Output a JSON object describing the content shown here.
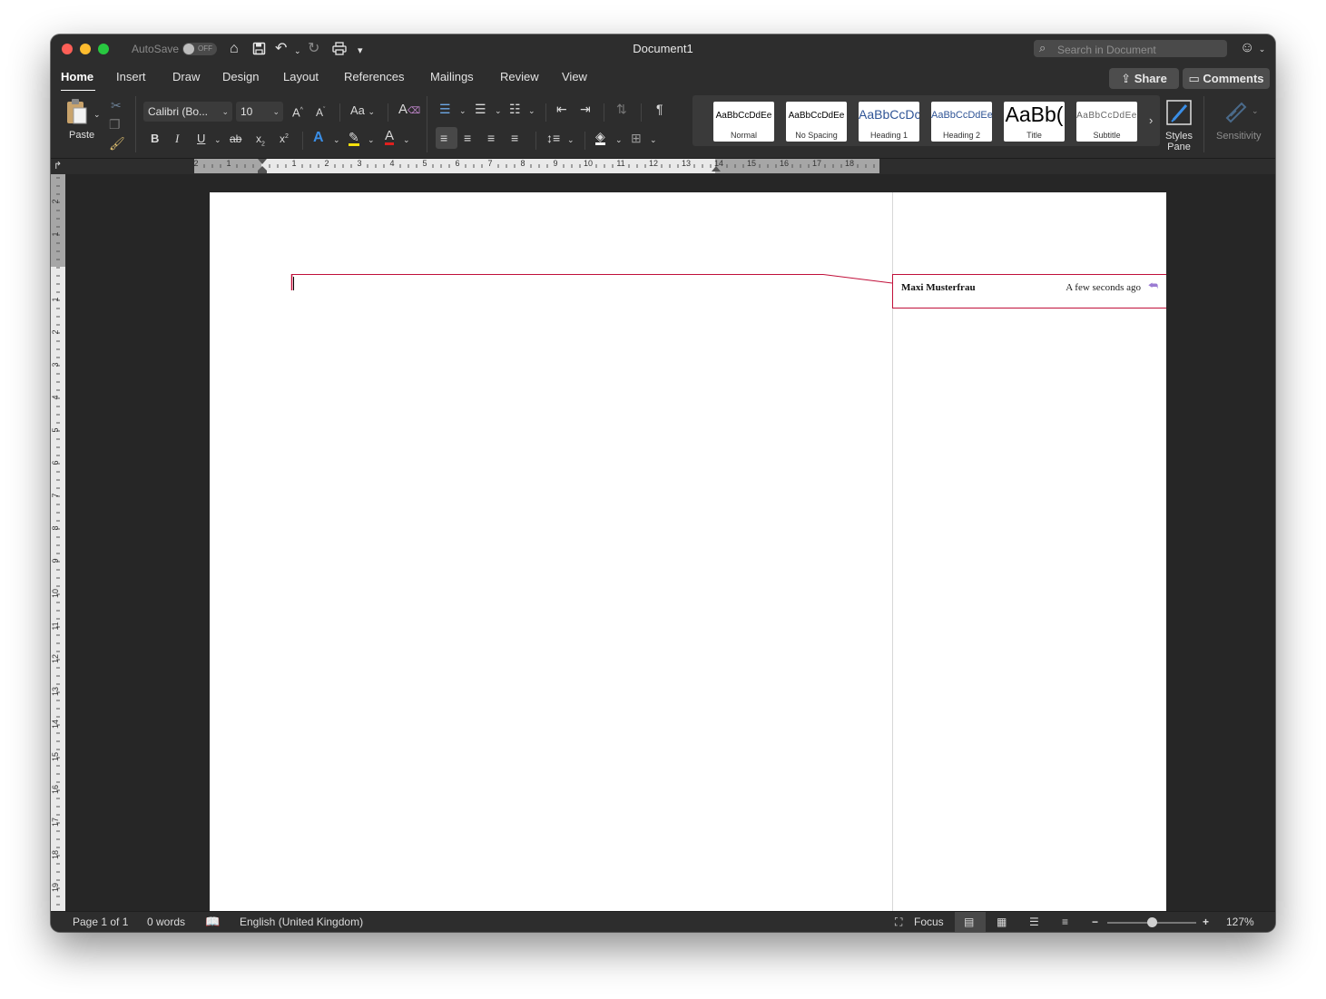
{
  "window": {
    "title": "Document1",
    "autosave_label": "AutoSave",
    "autosave_state": "OFF",
    "search_placeholder": "Search in Document"
  },
  "tabs": [
    {
      "label": "Home",
      "active": true
    },
    {
      "label": "Insert"
    },
    {
      "label": "Draw"
    },
    {
      "label": "Design"
    },
    {
      "label": "Layout"
    },
    {
      "label": "References"
    },
    {
      "label": "Mailings"
    },
    {
      "label": "Review"
    },
    {
      "label": "View"
    }
  ],
  "header_buttons": {
    "share": "Share",
    "comments": "Comments"
  },
  "ribbon": {
    "paste_label": "Paste",
    "font_name": "Calibri (Bo...",
    "font_size": "10",
    "change_case_label": "Aa",
    "styles": [
      {
        "sample": "AaBbCcDdEe",
        "label": "Normal",
        "color": "#000000"
      },
      {
        "sample": "AaBbCcDdEe",
        "label": "No Spacing",
        "color": "#000000"
      },
      {
        "sample": "AaBbCcDc",
        "label": "Heading 1",
        "color": "#2f5496"
      },
      {
        "sample": "AaBbCcDdEe",
        "label": "Heading 2",
        "color": "#2f5496"
      },
      {
        "sample": "AaBb(",
        "label": "Title",
        "color": "#000000"
      },
      {
        "sample": "AaBbCcDdEe",
        "label": "Subtitle",
        "color": "#666666"
      }
    ],
    "styles_pane_label": "Styles Pane",
    "sensitivity_label": "Sensitivity"
  },
  "ruler": {
    "h_labels": [
      "2",
      "1",
      "1",
      "2",
      "3",
      "4",
      "5",
      "6",
      "7",
      "8",
      "9",
      "10",
      "11",
      "12",
      "13",
      "14",
      "15",
      "16",
      "17",
      "18"
    ],
    "v_labels": [
      "2",
      "1",
      "1",
      "1",
      "2",
      "3",
      "4",
      "5",
      "6",
      "7",
      "8",
      "9",
      "10",
      "11",
      "12",
      "13",
      "14",
      "15",
      "16",
      "17",
      "18",
      "19"
    ]
  },
  "comment": {
    "author": "Maxi Musterfrau",
    "time": "A few seconds ago"
  },
  "status": {
    "page": "Page 1 of 1",
    "words": "0 words",
    "language": "English (United Kingdom)",
    "focus": "Focus",
    "zoom": "127%",
    "zoom_fraction": 0.5
  },
  "colors": {
    "comment_accent": "#c0103a",
    "window_bg": "#262626"
  }
}
